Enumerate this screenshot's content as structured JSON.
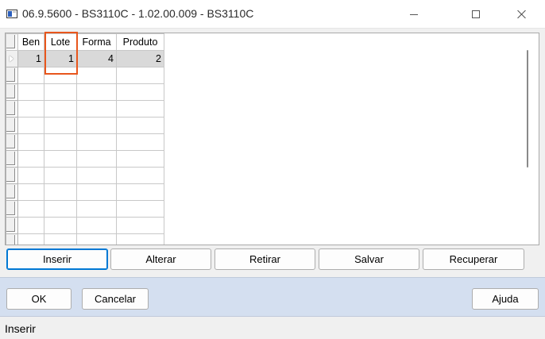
{
  "window": {
    "title": "06.9.5600 - BS3110C - 1.02.00.009 - BS3110C",
    "controls": {
      "minimize": "minimize-icon",
      "maximize": "maximize-icon",
      "close": "close-icon"
    }
  },
  "grid": {
    "columns": [
      "Ben",
      "Lote",
      "Forma",
      "Produto"
    ],
    "rows": [
      {
        "ben": "1",
        "lote": "1",
        "forma": "4",
        "produto": "2"
      }
    ],
    "highlighted_column": "Lote",
    "colors": {
      "highlight": "#e8561c",
      "selected_row": "#d9d9d9"
    }
  },
  "actions": {
    "inserir": "Inserir",
    "alterar": "Alterar",
    "retirar": "Retirar",
    "salvar": "Salvar",
    "recuperar": "Recuperar"
  },
  "dialog": {
    "ok": "OK",
    "cancelar": "Cancelar",
    "ajuda": "Ajuda",
    "panel_color": "#d4dff0"
  },
  "status": {
    "text": "Inserir"
  }
}
